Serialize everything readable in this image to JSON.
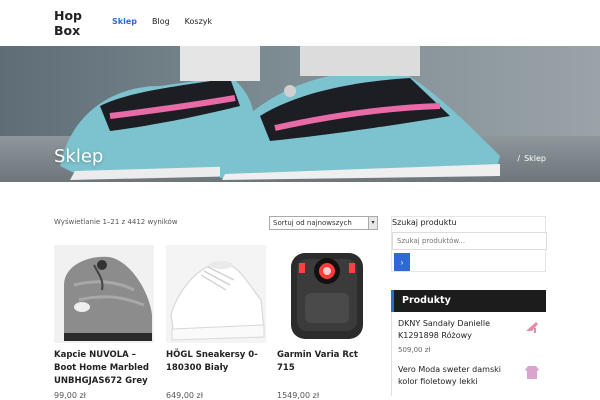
{
  "header": {
    "logo_line1": "Hop",
    "logo_line2": "Box",
    "nav": [
      {
        "label": "Sklep",
        "active": true
      },
      {
        "label": "Blog",
        "active": false
      },
      {
        "label": "Koszyk",
        "active": false
      }
    ]
  },
  "hero": {
    "title": "Sklep",
    "breadcrumb_home": "",
    "breadcrumb_separator": "/",
    "breadcrumb_current": "Sklep"
  },
  "shop": {
    "result_count": "Wyświetlanie 1–21 z 4412 wyników",
    "sort_selected": "Sortuj od najnowszych",
    "products": [
      {
        "name": "Kapcie NUVOLA – Boot Home Marbled UNBHGJAS672 Grey",
        "price": "99,00 zł",
        "icon": "slipper-image"
      },
      {
        "name": "HÖGL Sneakersy 0-180300 Biały",
        "price": "649,00 zł",
        "icon": "sneaker-image"
      },
      {
        "name": "Garmin Varia Rct 715",
        "price": "1549,00 zł",
        "icon": "bike-light-image"
      }
    ]
  },
  "sidebar": {
    "search_label": "Szukaj produktu",
    "search_placeholder": "Szukaj produktów...",
    "products_title": "Produkty",
    "items": [
      {
        "title": "DKNY Sandały Danielle K1291898 Różowy",
        "price": "509,00 zł",
        "icon": "sandal-image"
      },
      {
        "title": "Vero Moda sweter damski kolor fioletowy lekki",
        "price": "",
        "icon": "sweater-image"
      }
    ]
  },
  "colors": {
    "accent": "#2d6ad6",
    "widget_header": "#1c1c1c"
  }
}
